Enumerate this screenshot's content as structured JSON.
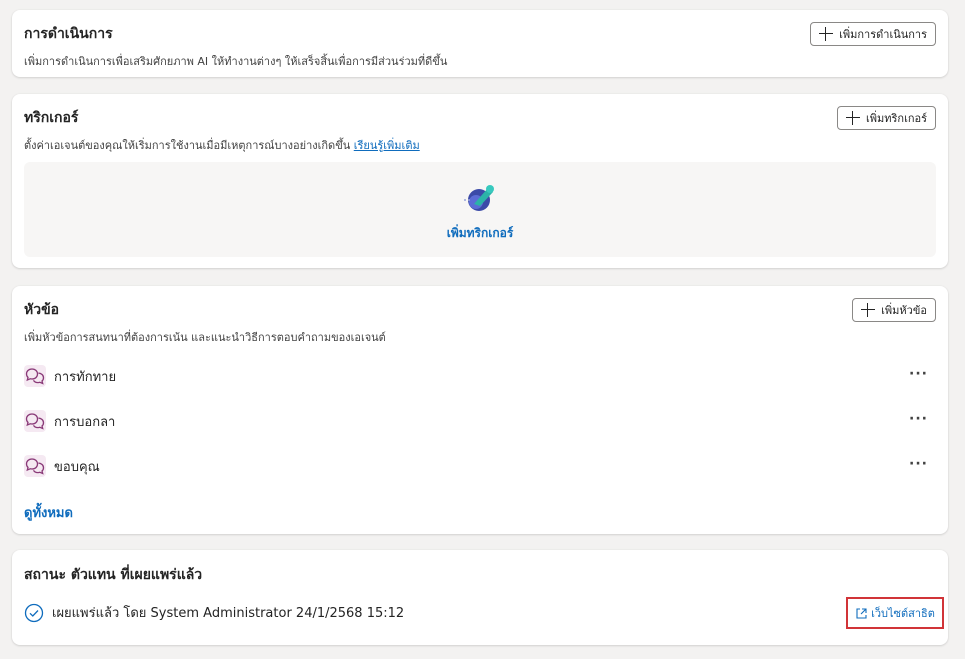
{
  "actions": {
    "title": "การดำเนินการ",
    "description": "เพิ่มการดำเนินการเพื่อเสริมศักยภาพ AI ให้ทำงานต่างๆ ให้เสร็จสิ้นเพื่อการมีส่วนร่วมที่ดีขึ้น",
    "add_label": "เพิ่มการดำเนินการ"
  },
  "triggers": {
    "title": "ทริกเกอร์",
    "description": "ตั้งค่าเอเจนต์ของคุณให้เริ่มการใช้งานเมื่อมีเหตุการณ์บางอย่างเกิดขึ้น",
    "learn_more": "เรียนรู้เพิ่มเติม",
    "add_label": "เพิ่มทริกเกอร์",
    "empty_cta": "เพิ่มทริกเกอร์"
  },
  "topics": {
    "title": "หัวข้อ",
    "description": "เพิ่มหัวข้อการสนทนาที่ต้องการเน้น และแนะนำวิธีการตอบคำถามของเอเจนต์",
    "add_label": "เพิ่มหัวข้อ",
    "items": [
      {
        "label": "การทักทาย"
      },
      {
        "label": "การบอกลา"
      },
      {
        "label": "ขอบคุณ"
      }
    ],
    "more_label": "···",
    "see_all": "ดูทั้งหมด"
  },
  "status": {
    "title": "สถานะ ตัวแทน ที่เผยแพร่แล้ว",
    "text": "เผยแพร่แล้ว โดย System Administrator 24/1/2568 15:12",
    "public_site": "เว็บไซต์สาธิต"
  },
  "colors": {
    "accent": "#0f6cbd",
    "highlight_border": "#d13438",
    "topic_icon": "#8a3a78"
  }
}
